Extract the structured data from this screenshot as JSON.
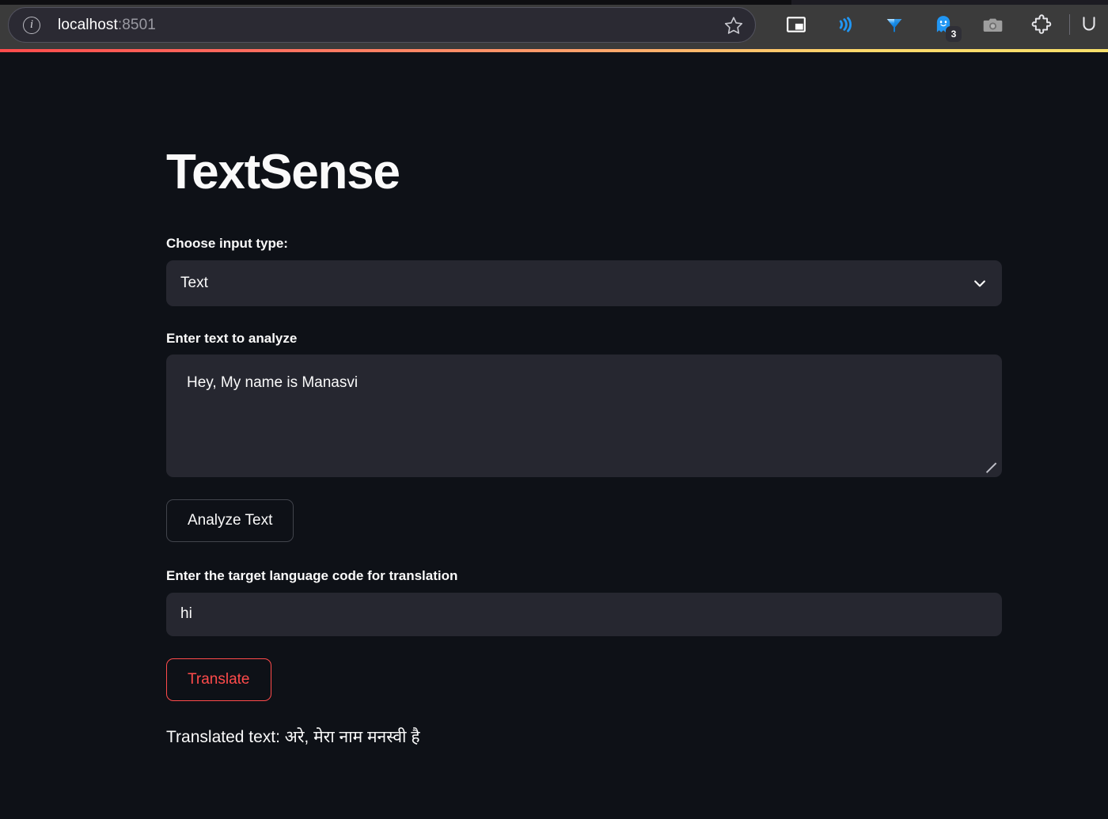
{
  "browser": {
    "url_protocol_host": "localhost",
    "url_port": ":8501",
    "bookmark_icon": "star-icon",
    "info_icon": "info-circle-icon",
    "toolbar_icons": [
      {
        "name": "picture-in-picture-icon",
        "label": ""
      },
      {
        "name": "sound-waves-icon",
        "label": ""
      },
      {
        "name": "gem-icon",
        "label": ""
      },
      {
        "name": "ghost-extension-icon",
        "badge": "3"
      },
      {
        "name": "camera-icon",
        "label": ""
      },
      {
        "name": "extensions-puzzle-icon",
        "label": ""
      }
    ],
    "accent_gradient_start": "#FF4B4B",
    "accent_gradient_end": "#F7E06B"
  },
  "app": {
    "title": "TextSense",
    "background_color": "#0E1117",
    "widget_background_color": "#262730",
    "accent_color": "#FF4B4B",
    "input_type": {
      "label": "Choose input type:",
      "value": "Text",
      "chevron_icon": "chevron-down-icon"
    },
    "analyze": {
      "label": "Enter text to analyze",
      "value": "Hey, My name is Manasvi",
      "placeholder": "",
      "button_label": "Analyze Text",
      "resize_handle_icon": "resize-grip-icon"
    },
    "translate": {
      "label": "Enter the target language code for translation",
      "value": "hi",
      "placeholder": "",
      "button_label": "Translate"
    },
    "result": {
      "text": "Translated text: अरे, मेरा नाम मनस्वी है"
    }
  }
}
